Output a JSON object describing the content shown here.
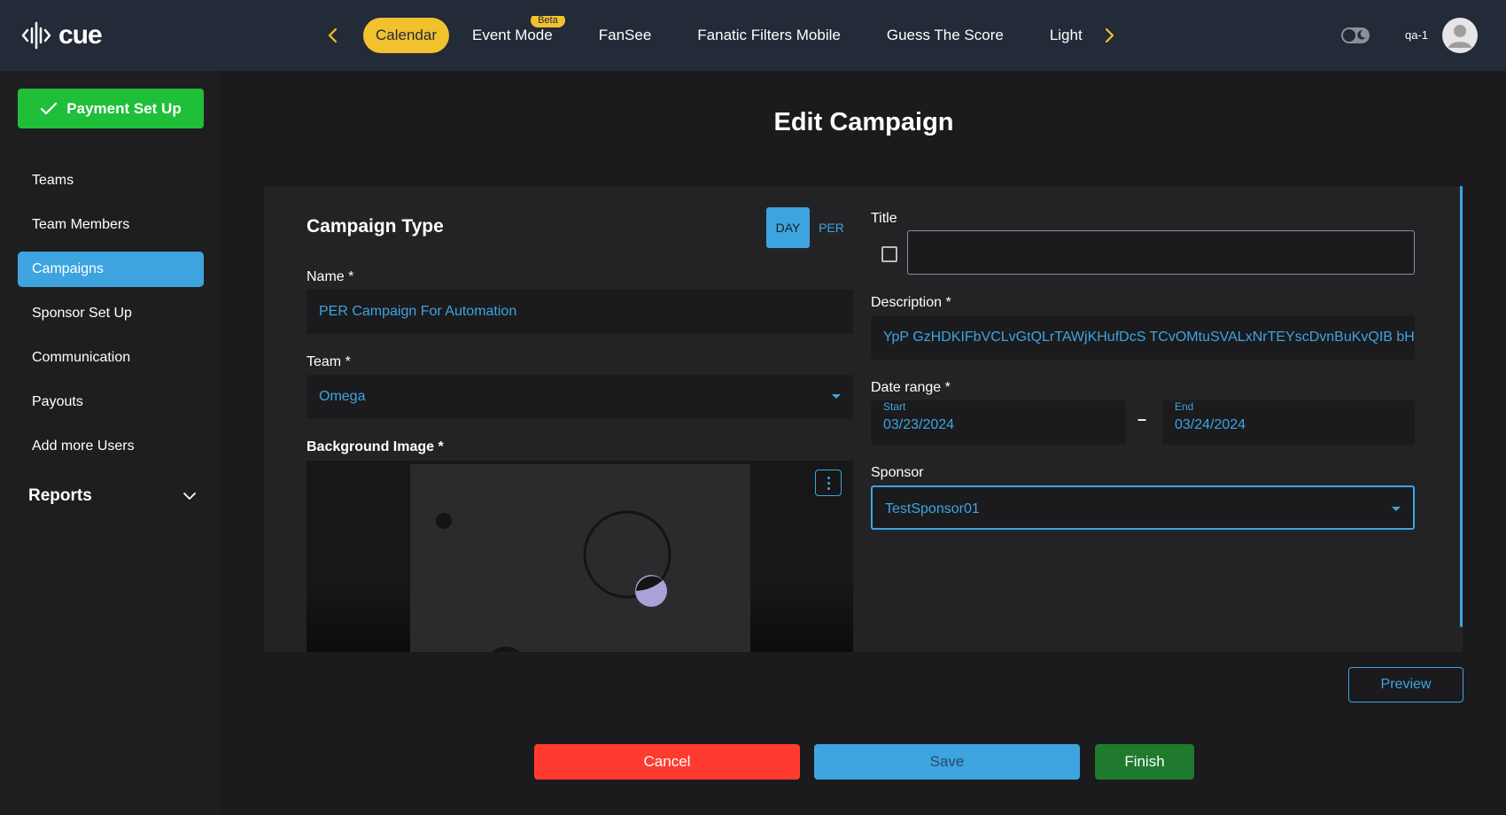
{
  "app": {
    "logo_text": "cue"
  },
  "header": {
    "tabs": [
      {
        "label": "Calendar",
        "active": true
      },
      {
        "label": "Event Mode",
        "badge": "Beta"
      },
      {
        "label": "FanSee"
      },
      {
        "label": "Fanatic Filters Mobile"
      },
      {
        "label": "Guess The Score"
      },
      {
        "label": "Light"
      }
    ],
    "left_arrow_icon": "chevron-left-icon",
    "right_arrow_icon": "chevron-right-icon",
    "theme_toggle_icon": "moon-icon",
    "username": "qa-1",
    "avatar_icon": "user-avatar-icon",
    "accent_color": "#f2c12e"
  },
  "sidebar": {
    "payment_button": "Payment Set Up",
    "items": [
      {
        "label": "Teams"
      },
      {
        "label": "Team Members"
      },
      {
        "label": "Campaigns",
        "active": true
      },
      {
        "label": "Sponsor Set Up"
      },
      {
        "label": "Communication"
      },
      {
        "label": "Payouts"
      },
      {
        "label": "Add more Users"
      }
    ],
    "reports_label": "Reports"
  },
  "main": {
    "page_title": "Edit Campaign",
    "campaign_type_label": "Campaign Type",
    "type_options": [
      "DAY",
      "PER"
    ],
    "type_selected": "DAY",
    "name_label": "Name *",
    "name_value": "PER Campaign For Automation",
    "team_label": "Team *",
    "team_value": "Omega",
    "background_label": "Background Image *",
    "title_label": "Title",
    "title_value": "",
    "description_label": "Description *",
    "description_value": "YpP GzHDKIFbVCLvGtQLrTAWjKHufDcS TCvOMtuSVALxNrTEYscDvnBuKvQIB bHexcJ",
    "date_range_label": "Date range *",
    "start_label": "Start",
    "start_value": "03/23/2024",
    "date_separator": "–",
    "end_label": "End",
    "end_value": "03/24/2024",
    "sponsor_label": "Sponsor",
    "sponsor_value": "TestSponsor01"
  },
  "actions": {
    "preview": "Preview",
    "cancel": "Cancel",
    "save": "Save",
    "finish": "Finish"
  },
  "colors": {
    "accent_blue": "#3ea4e0",
    "success_green": "#1fbf3a",
    "danger_red": "#ff3b30",
    "finish_green": "#1f7a2e"
  }
}
